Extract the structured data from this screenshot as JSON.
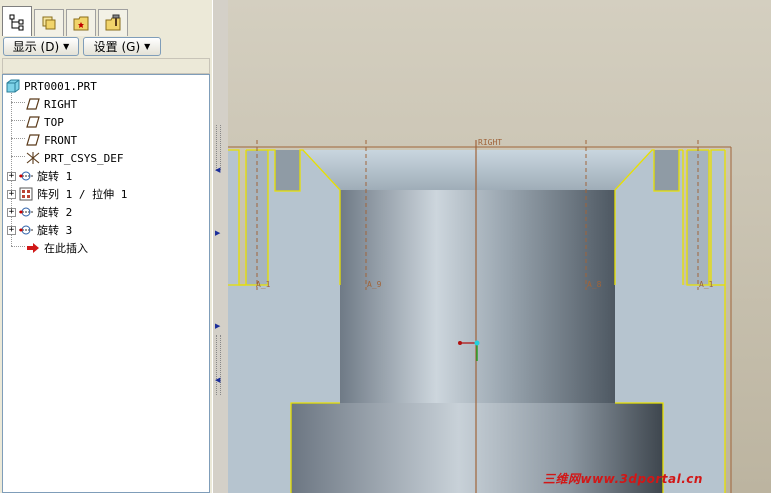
{
  "top_strip": {
    "label": ""
  },
  "navigator": {
    "tabs": [
      {
        "name": "model-tree",
        "active": true
      },
      {
        "name": "folder-browser",
        "active": false
      },
      {
        "name": "favorites",
        "active": false
      },
      {
        "name": "connections",
        "active": false
      }
    ],
    "display_menu": "显示 (D)",
    "settings_menu": "设置 (G)"
  },
  "model_tree": {
    "root": "PRT0001.PRT",
    "items": [
      {
        "label": "RIGHT",
        "icon": "datum-plane-icon",
        "expandable": false
      },
      {
        "label": "TOP",
        "icon": "datum-plane-icon",
        "expandable": false
      },
      {
        "label": "FRONT",
        "icon": "datum-plane-icon",
        "expandable": false
      },
      {
        "label": "PRT_CSYS_DEF",
        "icon": "csys-icon",
        "expandable": false
      },
      {
        "label": "旋转 1",
        "icon": "revolve-icon",
        "expandable": true
      },
      {
        "label": "阵列 1 / 拉伸 1",
        "icon": "pattern-icon",
        "expandable": true
      },
      {
        "label": "旋转 2",
        "icon": "revolve-icon",
        "expandable": true
      },
      {
        "label": "旋转 3",
        "icon": "revolve-icon",
        "expandable": true
      },
      {
        "label": "在此插入",
        "icon": "insert-here-arrow-icon",
        "expandable": false
      }
    ]
  },
  "viewport": {
    "datum_label_right": "RIGHT",
    "axis_labels": [
      "A_1",
      "A_9",
      "A_8",
      "A_1"
    ],
    "colors": {
      "background_top": "#c8c0a8",
      "model_face": "#b6c4cf",
      "highlight_edge": "#e8e000",
      "datum_line": "#a0643a"
    }
  },
  "watermark": "三维网www.3dportal.cn"
}
